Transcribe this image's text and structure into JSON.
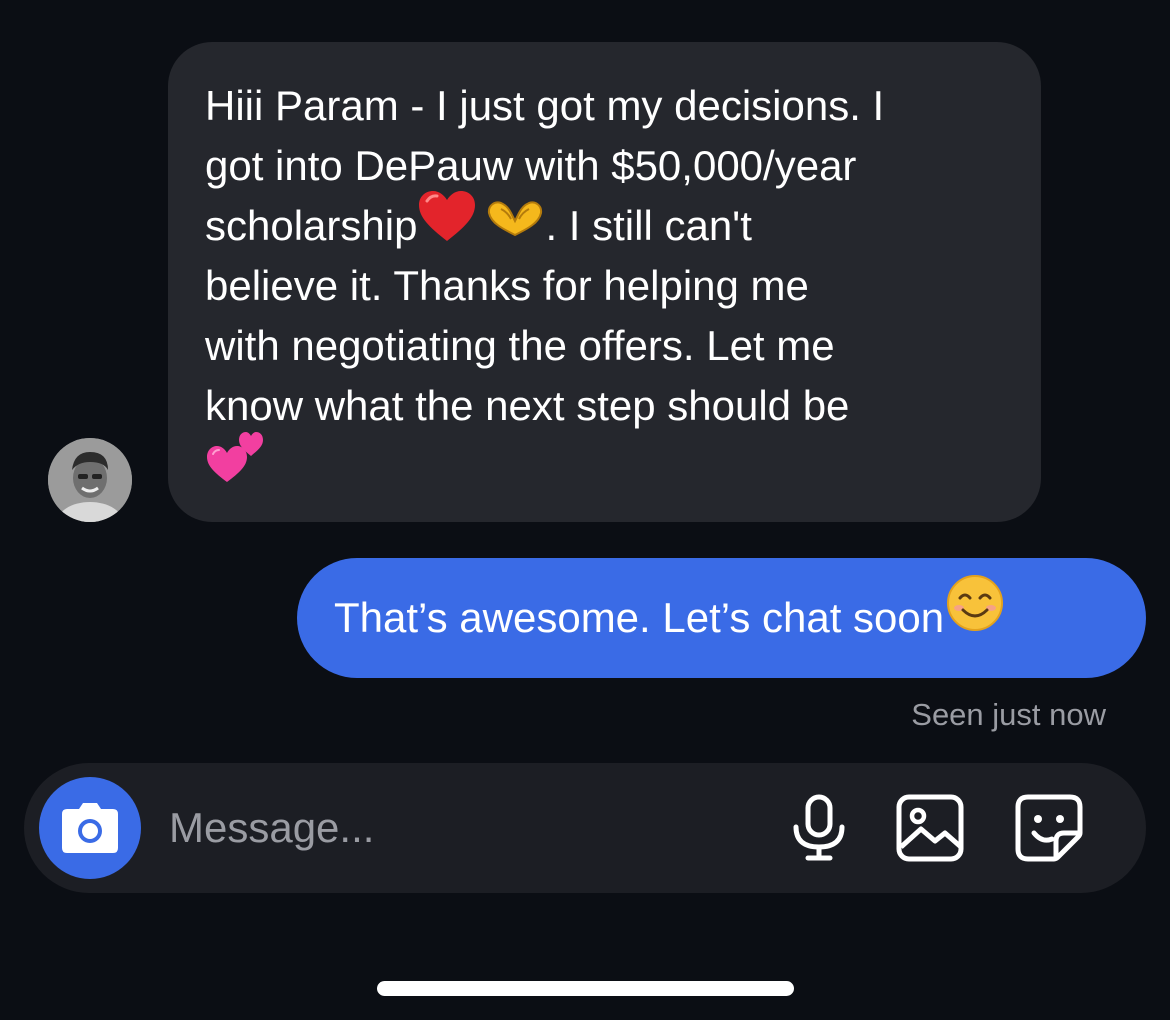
{
  "conversation": {
    "incoming": {
      "lines": [
        "Hiii Param - I just got my decisions. I",
        "got into DePauw with $50,000/year",
        "scholarship",
        ". I still can't",
        "believe it. Thanks for helping me",
        "with negotiating the offers. Let me",
        "know what the next step should be"
      ],
      "emojis": [
        "red-heart",
        "heart-hands",
        "two-hearts"
      ]
    },
    "outgoing": {
      "text": "That’s awesome. Let’s chat soon",
      "emoji": "smiling-face"
    },
    "seen_status": "Seen just now"
  },
  "composer": {
    "placeholder": "Message...",
    "icons": [
      "camera-icon",
      "microphone-icon",
      "image-icon",
      "sticker-icon"
    ]
  },
  "colors": {
    "background": "#0b0e14",
    "incoming_bubble": "#25272d",
    "outgoing_bubble": "#3a6be6",
    "composer": "#1c1e24",
    "secondary_text": "#9a9ca3"
  }
}
